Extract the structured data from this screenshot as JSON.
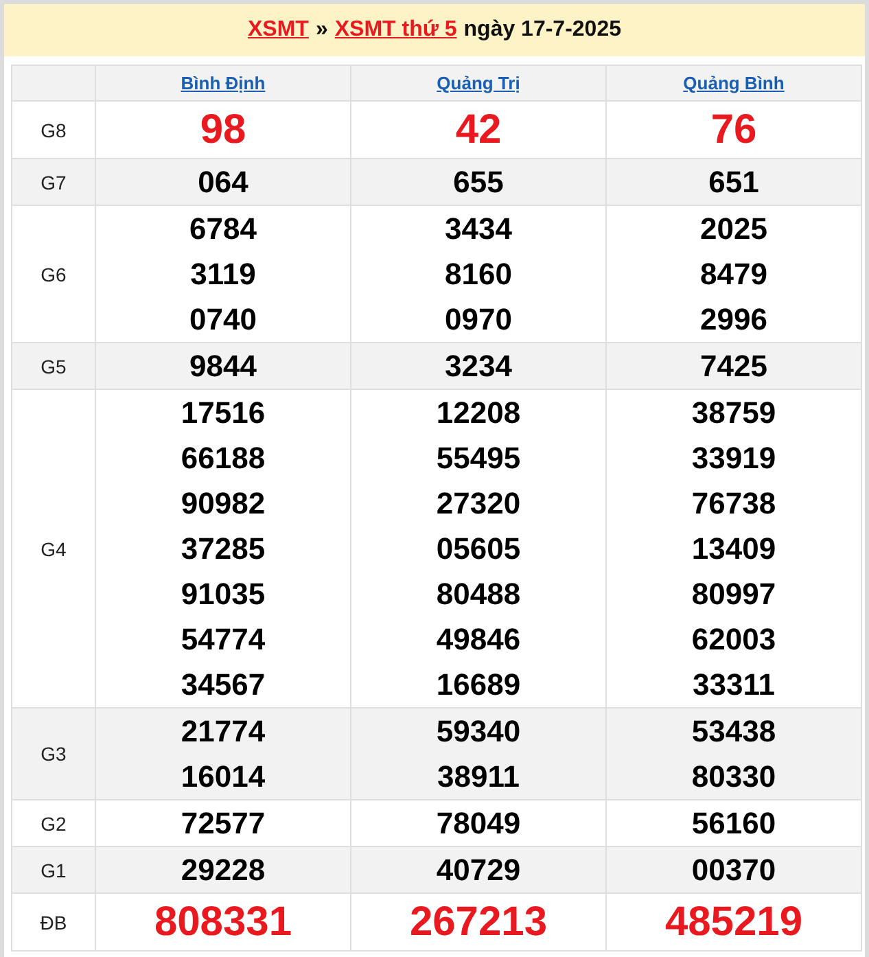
{
  "header": {
    "links": [
      "XSMT",
      "XSMT thứ 5"
    ],
    "separator": "»",
    "date_text": "ngày 17-7-2025"
  },
  "provinces": [
    "Bình Định",
    "Quảng Trị",
    "Quảng Bình"
  ],
  "prizes": [
    {
      "label": "G8",
      "highlight": true,
      "numbers": [
        [
          "98"
        ],
        [
          "42"
        ],
        [
          "76"
        ]
      ]
    },
    {
      "label": "G7",
      "highlight": false,
      "numbers": [
        [
          "064"
        ],
        [
          "655"
        ],
        [
          "651"
        ]
      ]
    },
    {
      "label": "G6",
      "highlight": false,
      "numbers": [
        [
          "6784",
          "3119",
          "0740"
        ],
        [
          "3434",
          "8160",
          "0970"
        ],
        [
          "2025",
          "8479",
          "2996"
        ]
      ]
    },
    {
      "label": "G5",
      "highlight": false,
      "numbers": [
        [
          "9844"
        ],
        [
          "3234"
        ],
        [
          "7425"
        ]
      ]
    },
    {
      "label": "G4",
      "highlight": false,
      "numbers": [
        [
          "17516",
          "66188",
          "90982",
          "37285",
          "91035",
          "54774",
          "34567"
        ],
        [
          "12208",
          "55495",
          "27320",
          "05605",
          "80488",
          "49846",
          "16689"
        ],
        [
          "38759",
          "33919",
          "76738",
          "13409",
          "80997",
          "62003",
          "33311"
        ]
      ]
    },
    {
      "label": "G3",
      "highlight": false,
      "numbers": [
        [
          "21774",
          "16014"
        ],
        [
          "59340",
          "38911"
        ],
        [
          "53438",
          "80330"
        ]
      ]
    },
    {
      "label": "G2",
      "highlight": false,
      "numbers": [
        [
          "72577"
        ],
        [
          "78049"
        ],
        [
          "56160"
        ]
      ]
    },
    {
      "label": "G1",
      "highlight": false,
      "numbers": [
        [
          "29228"
        ],
        [
          "40729"
        ],
        [
          "00370"
        ]
      ]
    },
    {
      "label": "ĐB",
      "highlight": true,
      "numbers": [
        [
          "808331"
        ],
        [
          "267213"
        ],
        [
          "485219"
        ]
      ]
    }
  ]
}
